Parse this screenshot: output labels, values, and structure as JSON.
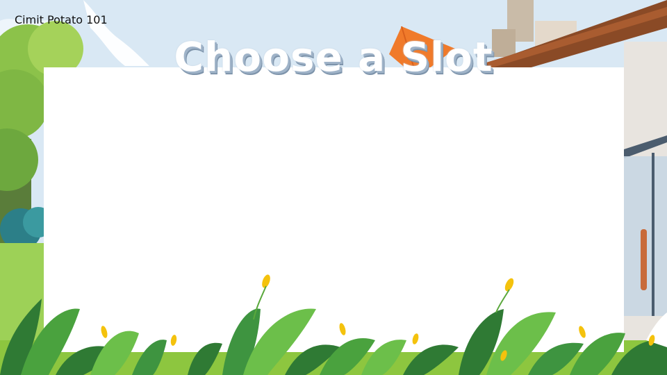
{
  "author_label": "Cimit Potato 101",
  "title": "Choose a Slot",
  "colors": {
    "sky": "#d9e8f4",
    "roof": "#8a4a26",
    "kite": "#f07a2a",
    "grass": "#8dc63f",
    "leaf_dark": "#2f7a34",
    "leaf_light": "#6cbf4a",
    "panel": "#ffffff",
    "title_shadow": "#8fa3b8"
  }
}
